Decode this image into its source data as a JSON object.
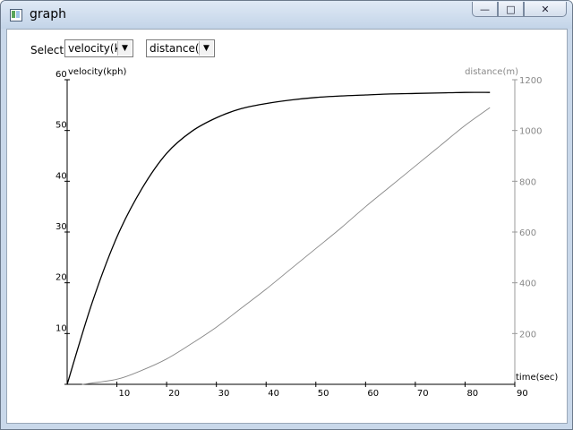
{
  "window": {
    "title": "graph",
    "buttons": {
      "minimize": "—",
      "maximize": "□",
      "close": "✕"
    }
  },
  "toolbar": {
    "select_label": "Select",
    "left_dropdown": {
      "value": "velocity(kph)"
    },
    "right_dropdown": {
      "value": "distance(m)"
    }
  },
  "colors": {
    "velocity": "#000000",
    "distance": "#888888"
  },
  "chart_data": {
    "type": "line",
    "xlabel": "time(sec)",
    "ylabel": "velocity(kph)",
    "y2label": "distance(m)",
    "xlim": [
      0,
      90
    ],
    "ylim": [
      0,
      60
    ],
    "y2lim": [
      0,
      1200
    ],
    "xticks": [
      10,
      20,
      30,
      40,
      50,
      60,
      70,
      80,
      90
    ],
    "yticks": [
      10,
      20,
      30,
      40,
      50,
      60
    ],
    "y2ticks": [
      200,
      400,
      600,
      800,
      1000,
      1200
    ],
    "series": [
      {
        "name": "velocity(kph)",
        "axis": "left",
        "x": [
          0,
          5,
          10,
          15,
          20,
          25,
          30,
          35,
          40,
          45,
          50,
          55,
          60,
          65,
          70,
          75,
          80,
          85
        ],
        "y": [
          0,
          16,
          29,
          38.5,
          45.5,
          49.8,
          52.5,
          54.3,
          55.3,
          56.0,
          56.5,
          56.8,
          57.0,
          57.2,
          57.3,
          57.4,
          57.5,
          57.5
        ]
      },
      {
        "name": "distance(m)",
        "axis": "right",
        "x": [
          3,
          10,
          15,
          20,
          25,
          30,
          35,
          40,
          45,
          50,
          55,
          60,
          65,
          70,
          75,
          80,
          85
        ],
        "y": [
          0,
          20,
          55,
          100,
          160,
          225,
          300,
          375,
          455,
          535,
          615,
          700,
          780,
          860,
          940,
          1020,
          1090
        ]
      }
    ]
  }
}
